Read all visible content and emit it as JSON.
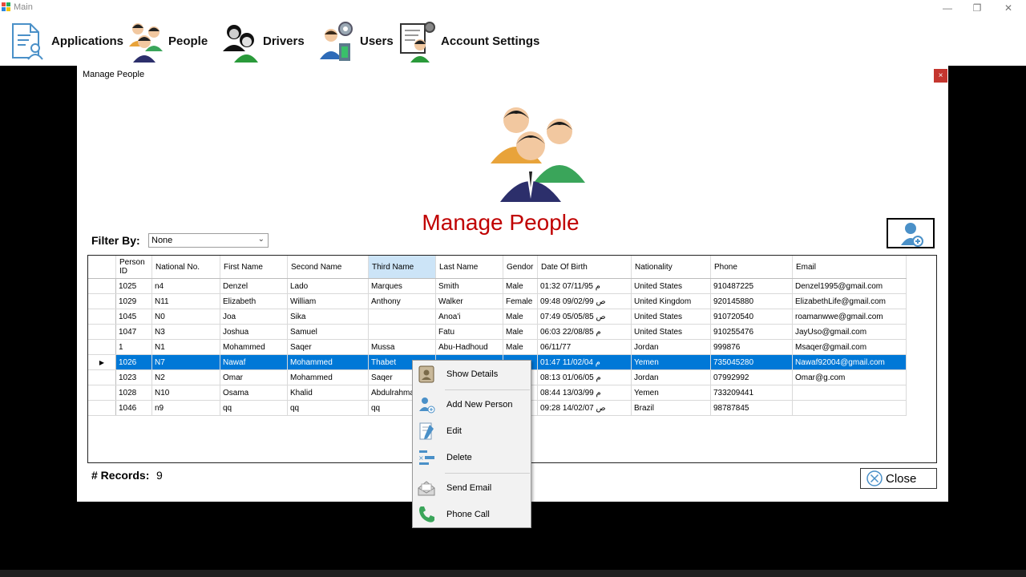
{
  "window": {
    "title": "Main",
    "minimize": "—",
    "maximize": "❐",
    "close": "✕"
  },
  "menu": {
    "items": [
      {
        "label": "Applications",
        "icon": "document-user-icon"
      },
      {
        "label": "People",
        "icon": "people-icon"
      },
      {
        "label": "Drivers",
        "icon": "drivers-icon"
      },
      {
        "label": "Users",
        "icon": "users-icon"
      },
      {
        "label": "Account Settings",
        "icon": "account-settings-icon"
      }
    ]
  },
  "form": {
    "title": "Manage People",
    "close": "×",
    "heading": "Manage People",
    "filter_label": "Filter By:",
    "filter_value": "None",
    "records_label": "# Records:",
    "records_value": "9",
    "close_button": "Close"
  },
  "grid": {
    "columns": [
      "Person ID",
      "National No.",
      "First Name",
      "Second Name",
      "Third Name",
      "Last Name",
      "Gendor",
      "Date Of Birth",
      "Nationality",
      "Phone",
      "Email"
    ],
    "rows": [
      [
        "1025",
        "n4",
        "Denzel",
        "Lado",
        "Marques",
        "Smith",
        "Male",
        "م 07/11/95 01:32",
        "United States",
        "910487225",
        "Denzel1995@gmail.com"
      ],
      [
        "1029",
        "N11",
        "Elizabeth",
        "William",
        "Anthony",
        "Walker",
        "Female",
        "ص 09/02/99 09:48",
        "United Kingdom",
        "920145880",
        "ElizabethLife@gmail.com"
      ],
      [
        "1045",
        "N0",
        "Joa",
        "Sika",
        "",
        "Anoa'i",
        "Male",
        "ص 05/05/85 07:49",
        "United States",
        "910720540",
        "roamanwwe@gmail.com"
      ],
      [
        "1047",
        "N3",
        "Joshua",
        "Samuel",
        "",
        "Fatu",
        "Male",
        "م 22/08/85 06:03",
        "United States",
        "910255476",
        "JayUso@gmail.com"
      ],
      [
        "1",
        "N1",
        "Mohammed",
        "Saqer",
        "Mussa",
        "Abu-Hadhoud",
        "Male",
        "06/11/77",
        "Jordan",
        "999876",
        "Msaqer@gmail.com"
      ],
      [
        "1026",
        "N7",
        "Nawaf",
        "Mohammed",
        "Thabet",
        "",
        "",
        "م 11/02/04 01:47",
        "Yemen",
        "735045280",
        "Nawaf92004@gmail.com"
      ],
      [
        "1023",
        "N2",
        "Omar",
        "Mohammed",
        "Saqer",
        "",
        "",
        "م 01/06/05 08:13",
        "Jordan",
        "07992992",
        "Omar@g.com"
      ],
      [
        "1028",
        "N10",
        "Osama",
        "Khalid",
        "Abdulrahman",
        "",
        "",
        "م 13/03/99 08:44",
        "Yemen",
        "733209441",
        ""
      ],
      [
        "1046",
        "n9",
        "qq",
        "qq",
        "qq",
        "",
        "",
        "ص 14/02/07 09:28",
        "Brazil",
        "98787845",
        ""
      ]
    ],
    "selected_row": 5,
    "sorted_column": "Third Name"
  },
  "context_menu": {
    "items": [
      {
        "label": "Show Details",
        "icon": "id-card-icon"
      },
      {
        "label": "Add New Person",
        "icon": "add-person-icon"
      },
      {
        "label": "Edit",
        "icon": "edit-icon"
      },
      {
        "label": "Delete",
        "icon": "delete-icon"
      },
      {
        "label": "Send Email",
        "icon": "mail-icon"
      },
      {
        "label": "Phone Call",
        "icon": "phone-icon"
      }
    ]
  },
  "colors": {
    "accent": "#0078d7",
    "heading": "#c00000",
    "sorted_header": "#cce4f7",
    "close_red": "#c4362f"
  }
}
